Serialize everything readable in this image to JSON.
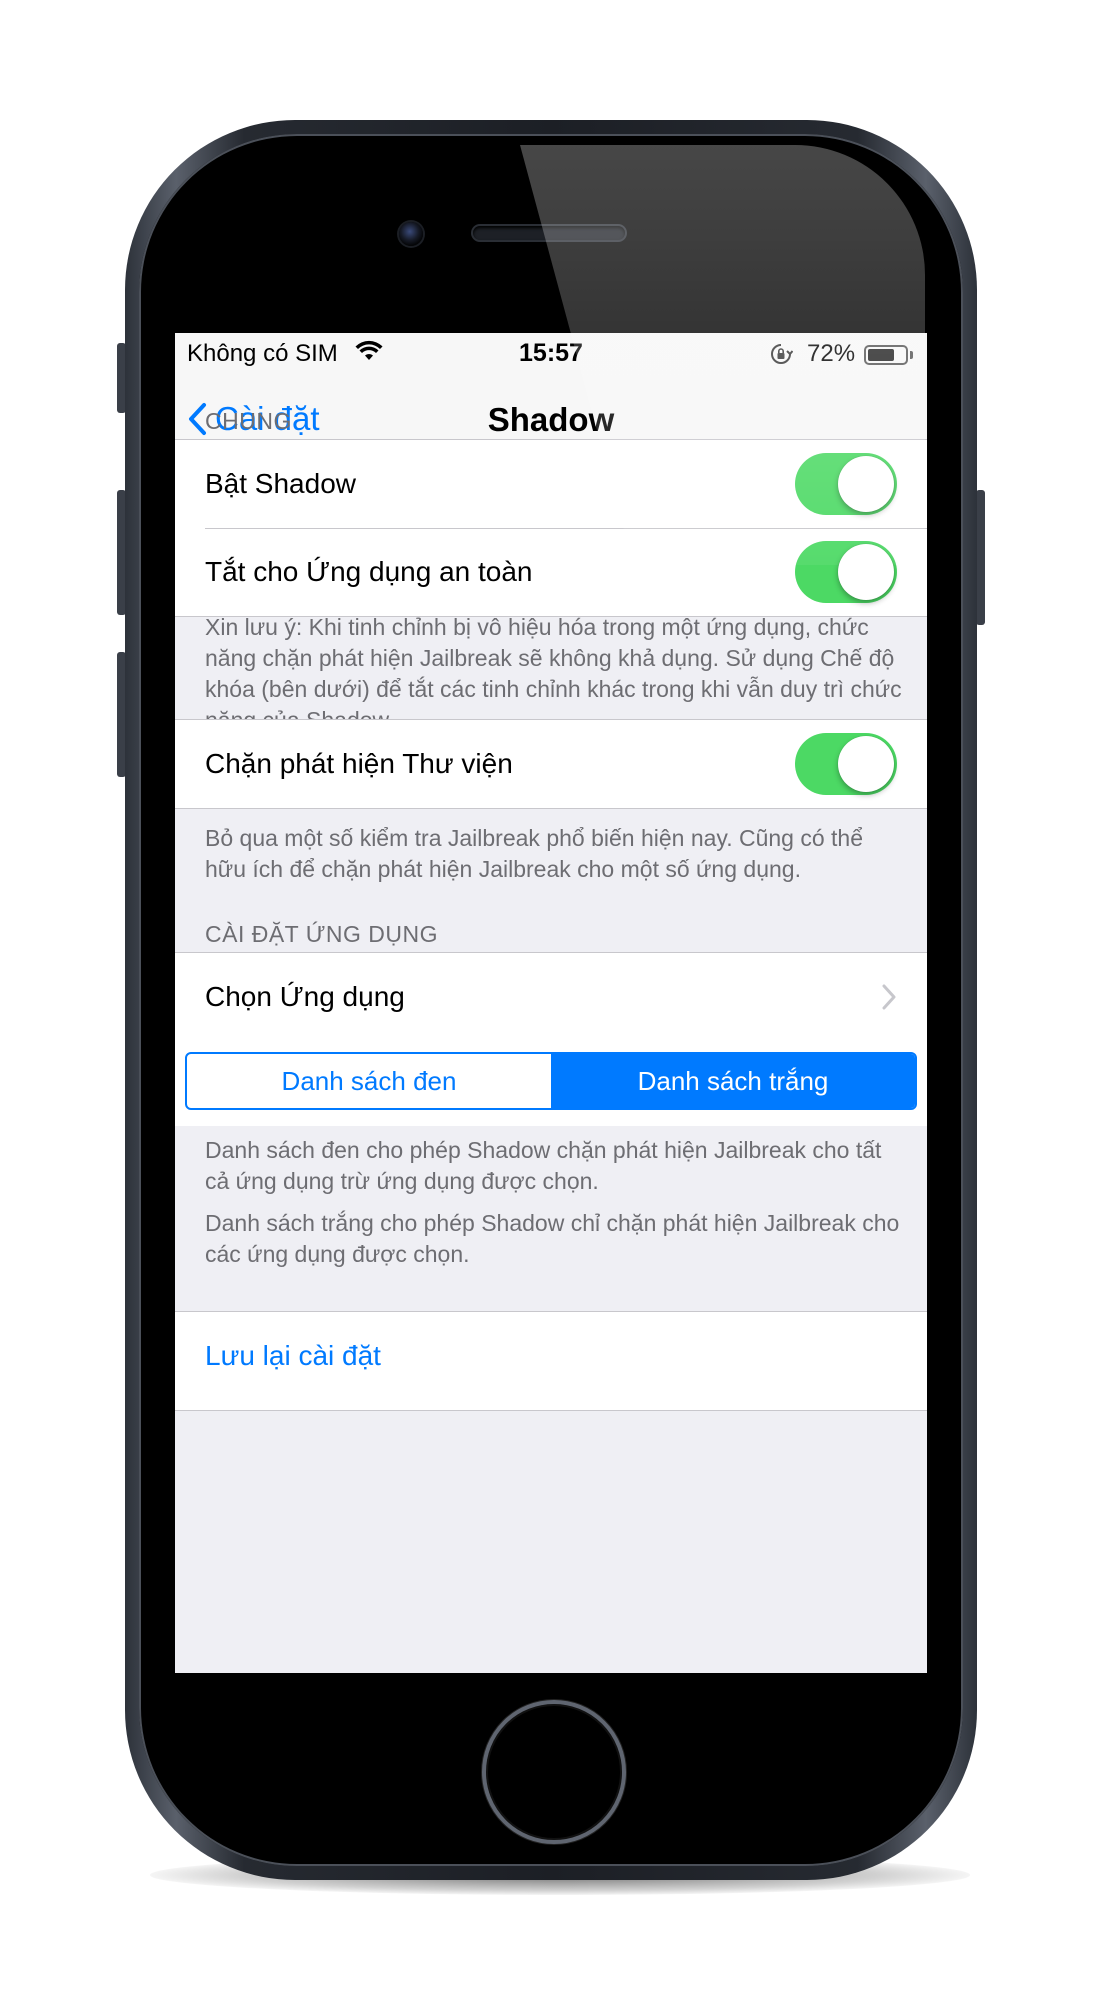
{
  "status_bar": {
    "carrier": "Không có SIM",
    "time": "15:57",
    "battery_percent": "72%",
    "battery_level": 0.72,
    "icons": [
      "wifi-icon",
      "orientation-lock-icon",
      "battery-icon"
    ]
  },
  "nav": {
    "back_label": "Cài đặt",
    "title": "Shadow"
  },
  "sections": {
    "general": {
      "header": "CHUNG",
      "items": [
        {
          "label": "Bật Shadow",
          "on": true
        },
        {
          "label": "Tắt cho Ứng dụng an toàn",
          "on": true
        }
      ],
      "footer": "Xin lưu ý: Khi tinh chỉnh bị vô hiệu hóa trong một ứng dụng, chức năng chặn phát hiện Jailbreak sẽ không khả dụng. Sử dụng Chế độ khóa (bên dưới) để tắt các tinh chỉnh khác trong khi vẫn duy trì chức năng của Shadow."
    },
    "library": {
      "items": [
        {
          "label": "Chặn phát hiện Thư viện",
          "on": true
        }
      ],
      "footer": "Bỏ qua một số kiểm tra Jailbreak phổ biến hiện nay. Cũng có thể hữu ích để chặn phát hiện Jailbreak cho một số ứng dụng."
    },
    "app_settings": {
      "header": "CÀI ĐẶT ỨNG DỤNG",
      "choose_app_label": "Chọn Ứng dụng",
      "segments": [
        "Danh sách đen",
        "Danh sách trắng"
      ],
      "selected_segment": "Danh sách trắng",
      "footer_blacklist": "Danh sách đen cho phép Shadow chặn phát hiện Jailbreak cho tất cả ứng dụng trừ ứng dụng được chọn.",
      "footer_whitelist": "Danh sách trắng cho phép Shadow chỉ chặn phát hiện Jailbreak cho các ứng dụng được chọn."
    },
    "save": {
      "label": "Lưu lại cài đặt"
    }
  },
  "colors": {
    "accent": "#007aff",
    "toggle_on": "#4cd964",
    "background": "#efeff4"
  }
}
